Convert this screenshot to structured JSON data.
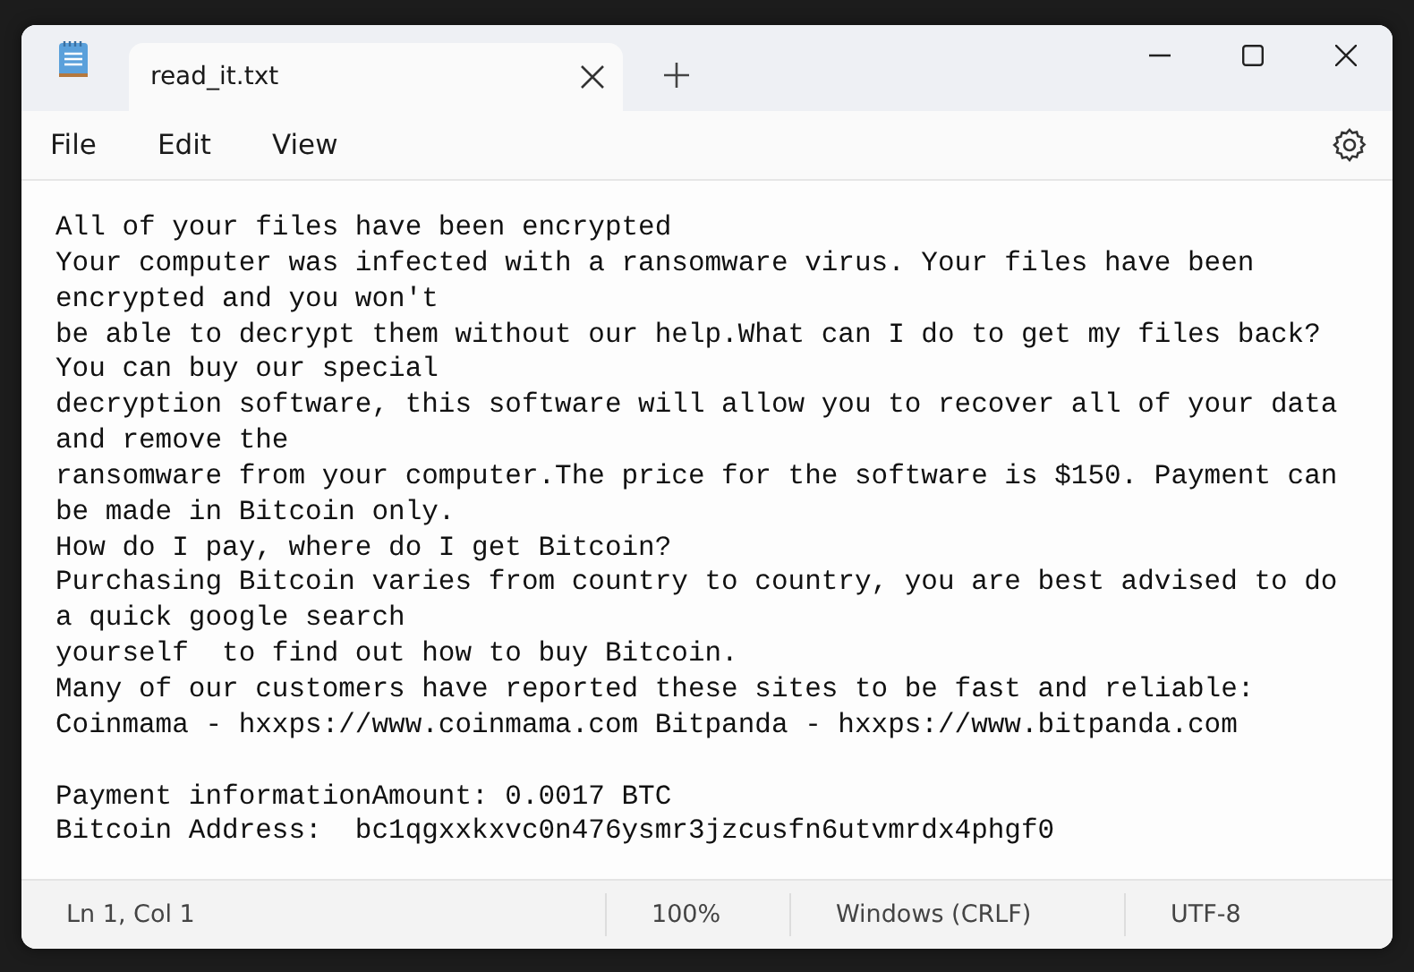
{
  "tabs": [
    {
      "label": "read_it.txt",
      "selected": true
    }
  ],
  "menu": [
    "File",
    "Edit",
    "View"
  ],
  "document_blocks": [
    [
      "All of your files have been encrypted",
      "Your computer was infected with a ransomware virus. Your files have been",
      "encrypted and you won't",
      "be able to decrypt them without our help.What can I do to get my files back?",
      "You can buy our special",
      "decryption software, this software will allow you to recover all of your data",
      "and remove the",
      "ransomware from your computer.The price for the software is $150. Payment can",
      "be made in Bitcoin only.",
      "How do I pay, where do I get Bitcoin?",
      "Purchasing Bitcoin varies from country to country, you are best advised to do",
      "a quick google search",
      "yourself  to find out how to buy Bitcoin.",
      "Many of our customers have reported these sites to be fast and reliable:",
      "Coinmama - hxxps://www.coinmama.com Bitpanda - hxxps://www.bitpanda.com"
    ],
    [
      "Payment informationAmount: 0.0017 BTC",
      "Bitcoin Address:  bc1qgxxkxvc0n476ysmr3jzcusfn6utvmrdx4phgf0"
    ]
  ],
  "status_bar": {
    "position": "Ln 1, Col 1",
    "zoom": "100%",
    "line_endings": "Windows (CRLF)",
    "encoding": "UTF-8"
  }
}
